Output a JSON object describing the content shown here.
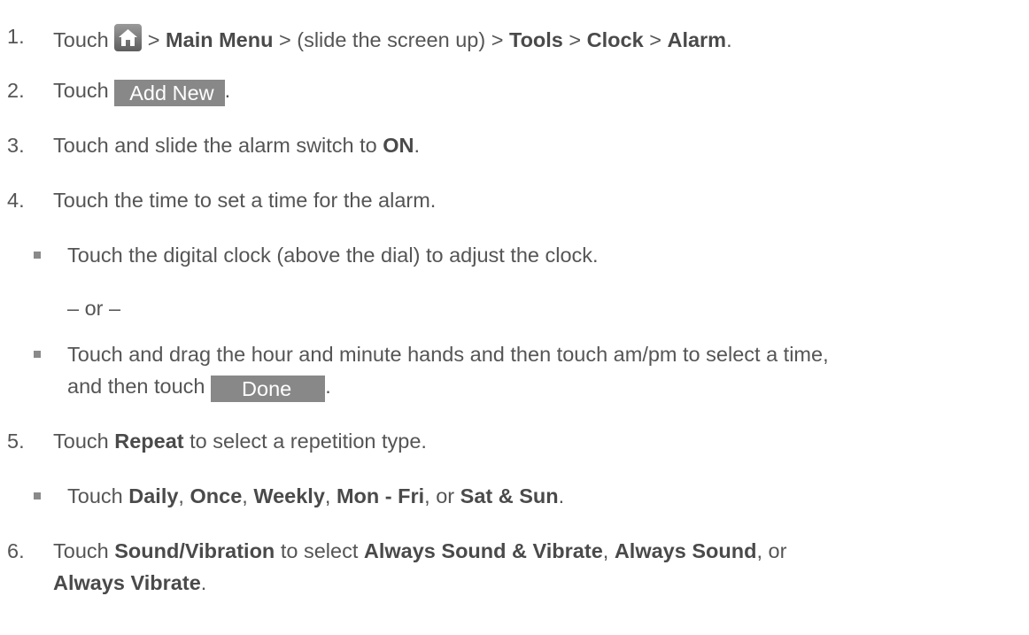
{
  "steps": [
    {
      "num": "1.",
      "parts": [
        "Touch ",
        " > ",
        "Main Menu",
        " > (slide the screen up) > ",
        "Tools",
        " > ",
        "Clock",
        " > ",
        "Alarm",
        "."
      ]
    },
    {
      "num": "2.",
      "parts": [
        "Touch ",
        "Add New",
        "."
      ]
    },
    {
      "num": "3.",
      "parts": [
        "Touch and slide the alarm switch to ",
        "ON",
        "."
      ]
    },
    {
      "num": "4.",
      "parts": [
        "Touch the time to set a time for the alarm."
      ]
    },
    {
      "num": "5.",
      "parts": [
        "Touch ",
        "Repeat",
        " to select a repetition type."
      ]
    },
    {
      "num": "6.",
      "parts": [
        "Touch ",
        "Sound/Vibration",
        " to select ",
        "Always Sound & Vibrate",
        ", ",
        "Always Sound",
        ", or",
        "Always Vibrate",
        "."
      ]
    }
  ],
  "sub": {
    "digital": "Touch the digital clock (above the dial) to adjust the clock.",
    "or": "– or –",
    "drag": "Touch and drag the hour and minute hands and then touch am/pm to select a time,",
    "drag2": [
      "and then touch ",
      "Done",
      "."
    ],
    "repeat": [
      "Touch ",
      "Daily",
      ", ",
      "Once",
      ", ",
      "Weekly",
      ", ",
      "Mon - Fri",
      ", or ",
      "Sat & Sun",
      "."
    ]
  },
  "icons": {
    "home": "home-icon"
  }
}
